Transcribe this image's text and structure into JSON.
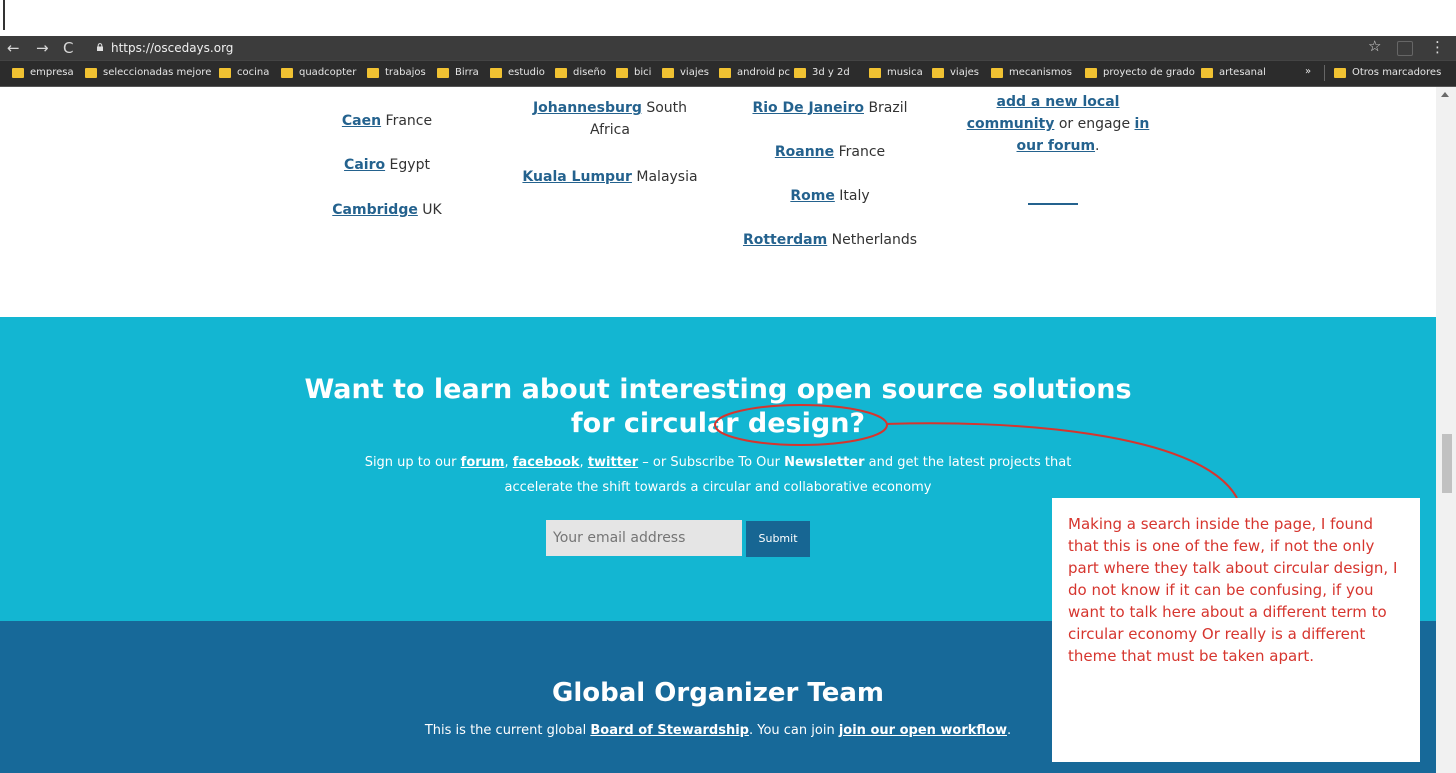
{
  "browser": {
    "url": "https://oscedays.org",
    "bookmarks": [
      "empresa",
      "seleccionadas mejore",
      "cocina",
      "quadcopter",
      "trabajos",
      "Birra",
      "estudio",
      "diseño",
      "bici",
      "viajes",
      "android pc",
      "3d y 2d",
      "musica",
      "viajes",
      "mecanismos",
      "proyecto de grado",
      "artesanal"
    ],
    "bookmarks_overflow": "»",
    "other_bookmarks": "Otros marcadores"
  },
  "cities": {
    "col1": [
      {
        "name": "Caen",
        "country": "France"
      },
      {
        "name": "Cairo",
        "country": "Egypt"
      },
      {
        "name": "Cambridge",
        "country": "UK"
      }
    ],
    "col2": [
      {
        "name": "Johannesburg",
        "country_line1": "South",
        "country_line2": "Africa"
      },
      {
        "name": "Kuala Lumpur",
        "country": "Malaysia"
      }
    ],
    "col3": [
      {
        "name": "Rio De Janeiro",
        "country": "Brazil"
      },
      {
        "name": "Roanne",
        "country": "France"
      },
      {
        "name": "Rome",
        "country": "Italy"
      },
      {
        "name": "Rotterdam",
        "country": "Netherlands"
      }
    ],
    "col4": {
      "link1_line1": "add a new local",
      "link1_line2": "community",
      "text_mid": "or engage",
      "link2_a": "in",
      "link2_b": "our forum",
      "period": "."
    }
  },
  "cta": {
    "heading_line1": "Want to learn about interesting open source solutions",
    "heading_line2": "for circular design?",
    "text_before": "Sign up to our",
    "forum": "forum",
    "comma1": ",",
    "facebook": "facebook",
    "comma2": ",",
    "twitter": "twitter",
    "text_mid": "– or Subscribe To Our",
    "newsletter": "Newsletter",
    "text_after": "and get the latest projects that",
    "line2": "accelerate the shift towards a circular and collaborative economy",
    "email_placeholder": "Your email address",
    "submit": "Submit"
  },
  "team": {
    "heading": "Global Organizer Team",
    "text_before": "This is the current global",
    "board": "Board of Stewardship",
    "text_mid": ". You can join",
    "workflow": "join our open workflow",
    "period": "."
  },
  "annotation": {
    "note": "Making a search inside the page, I found that this is one of the few, if not the only part where they talk about circular design, I do not know if it can be confusing, if you want to talk here about a different term to circular economy Or really is a different theme that must be taken apart.",
    "color": "#d6352e"
  }
}
